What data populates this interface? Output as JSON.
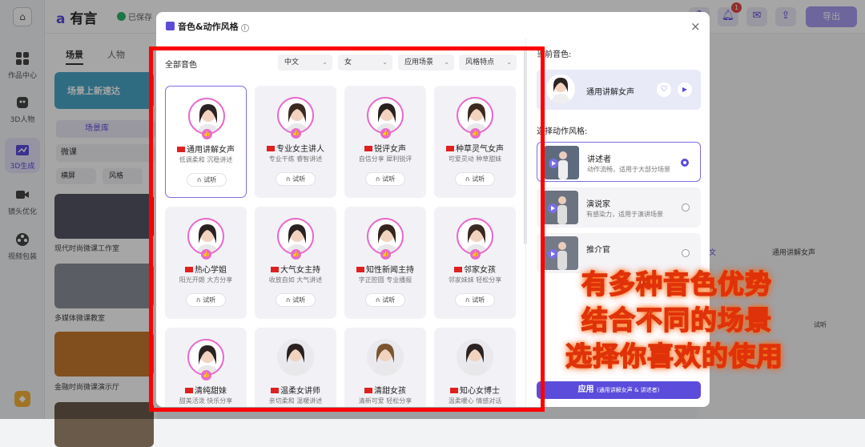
{
  "app": {
    "logo_text": "有言",
    "saved_text": "已保存",
    "export_label": "导出",
    "notification_count": "1"
  },
  "sidebar": {
    "items": [
      {
        "label": "作品中心",
        "icon": "grid-icon"
      },
      {
        "label": "3D人物",
        "icon": "person-icon"
      },
      {
        "label": "3D生成",
        "icon": "chart-icon"
      },
      {
        "label": "镜头优化",
        "icon": "camera-icon"
      },
      {
        "label": "视频包装",
        "icon": "film-icon"
      }
    ]
  },
  "panel": {
    "tabs": [
      "场景",
      "人物"
    ],
    "banner_text": "场景上新速达",
    "sub_tab": "场景库",
    "search_value": "微课",
    "filters": [
      "横屏",
      "风格"
    ],
    "thumbs": [
      "现代时尚微课工作室",
      "多媒体微课教室",
      "金融时尚微课演示厅"
    ]
  },
  "background_right": {
    "voice_label": "中文",
    "voice_name": "通用讲解女声",
    "listen_label": "试听"
  },
  "modal": {
    "title": "音色&动作风格",
    "close_label": "×",
    "all_voices_label": "全部音色",
    "filters": [
      {
        "label": "中文"
      },
      {
        "label": "女"
      },
      {
        "label": "应用场景"
      },
      {
        "label": "风格特点"
      }
    ],
    "voices": [
      {
        "name": "通用讲解女声",
        "desc": "低调柔和 沉稳讲述",
        "badge": true
      },
      {
        "name": "专业女主讲人",
        "desc": "专业干练 睿智讲述",
        "badge": true
      },
      {
        "name": "锐评女声",
        "desc": "自信分享 犀利锐评",
        "badge": true
      },
      {
        "name": "种草灵气女声",
        "desc": "可爱灵动 种草甜妹",
        "badge": true
      },
      {
        "name": "热心学姐",
        "desc": "阳光开朗 大方分享",
        "badge": true
      },
      {
        "name": "大气女主持",
        "desc": "收放自如 大气讲述",
        "badge": true
      },
      {
        "name": "知性新闻主持",
        "desc": "字正腔圆 专业播报",
        "badge": true
      },
      {
        "name": "邻家女孩",
        "desc": "邻家妹妹 轻松分享",
        "badge": true
      },
      {
        "name": "清纯甜妹",
        "desc": "甜美活泼 快乐分享",
        "badge": true
      },
      {
        "name": "温柔女讲师",
        "desc": "亲切柔和 温暖讲述",
        "badge": false
      },
      {
        "name": "清甜女孩",
        "desc": "清新可爱 轻松分享",
        "badge": false
      },
      {
        "name": "知心女博士",
        "desc": "温柔暖心 情感对话",
        "badge": false
      }
    ],
    "listen_label": "试听",
    "current_voice_label": "当前音色:",
    "current_voice_name": "通用讲解女声",
    "style_label": "选择动作风格:",
    "styles": [
      {
        "name": "讲述者",
        "desc": "动作流畅，适用于大部分场景",
        "selected": true
      },
      {
        "name": "演说家",
        "desc": "有感染力，适用于演讲场景",
        "selected": false
      },
      {
        "name": "推介官",
        "desc": "",
        "selected": false
      }
    ],
    "apply_label": "应用",
    "apply_detail": "(通用讲解女声 & 讲述者)"
  },
  "captions": [
    "有多种音色优势",
    "结合不同的场景",
    "选择你喜欢的使用"
  ],
  "colors": {
    "accent": "#5b4cdb",
    "highlight_border": "#ff0000",
    "avatar_ring": "#e86acb"
  }
}
